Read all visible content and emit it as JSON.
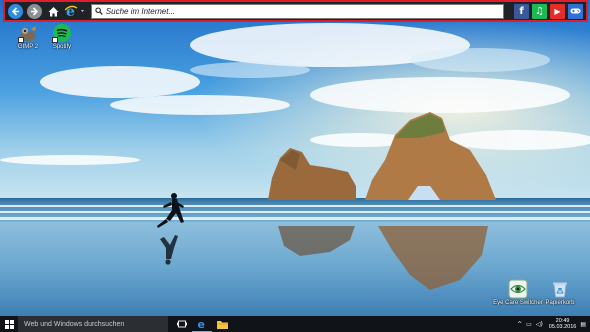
{
  "toolbar": {
    "search_placeholder": "Suche im Internet...",
    "buttons": [
      "back-icon",
      "forward-icon",
      "home-icon",
      "internet-explorer-icon"
    ],
    "socials": [
      {
        "name": "facebook",
        "glyph": "f",
        "color": "#3b5998"
      },
      {
        "name": "spotify",
        "glyph": "♫",
        "color": "#1db954"
      },
      {
        "name": "youtube",
        "glyph": "▶",
        "color": "#e52d27"
      },
      {
        "name": "gamepad",
        "glyph": "🎮",
        "color": "#2f6fd6"
      }
    ],
    "border_color": "#e01e2b"
  },
  "desktop": {
    "icons": [
      {
        "label": "GIMP 2"
      },
      {
        "label": "Spotify"
      },
      {
        "label": "Eye Care Switcher"
      },
      {
        "label": "Papierkorb"
      }
    ]
  },
  "taskbar": {
    "search_text": "Web und Windows durchsuchen",
    "time": "20:49",
    "date": "05.03.2016"
  }
}
